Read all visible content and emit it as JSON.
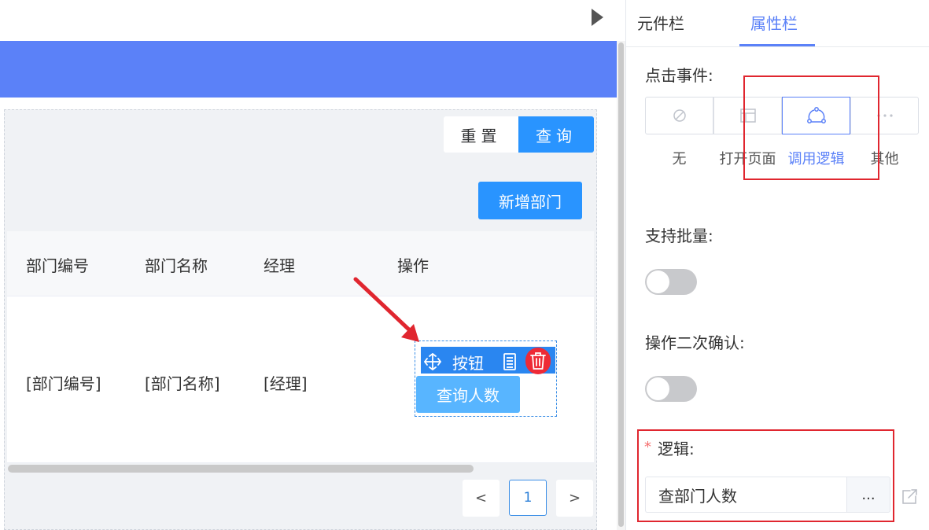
{
  "panel": {
    "tabs": [
      {
        "label": "元件栏"
      },
      {
        "label": "属性栏"
      }
    ],
    "click_event": {
      "label": "点击事件:",
      "options": [
        {
          "label": "无",
          "icon": "ban-icon"
        },
        {
          "label": "打开页面",
          "icon": "window-icon"
        },
        {
          "label": "调用逻辑",
          "icon": "flow-icon"
        },
        {
          "label": "其他",
          "icon": "ellipsis-icon"
        }
      ],
      "selected": "调用逻辑"
    },
    "batch": {
      "label": "支持批量:"
    },
    "confirm": {
      "label": "操作二次确认:"
    },
    "logic": {
      "required_mark": "*",
      "label": "逻辑:",
      "value": "查部门人数",
      "more": "..."
    }
  },
  "canvas": {
    "form": {
      "reset": "重置",
      "query": "查询"
    },
    "toolbar": {
      "add_dept": "新增部门"
    },
    "table": {
      "headers": [
        "部门编号",
        "部门名称",
        "经理",
        "操作"
      ],
      "row": [
        "[部门编号]",
        "[部门名称]",
        "[经理]"
      ]
    },
    "widget": {
      "label": "按钮",
      "button": "查询人数"
    },
    "pagination": {
      "prev": "<",
      "current": "1",
      "next": ">"
    }
  },
  "colors": {
    "banner": "#5b81f8",
    "primary": "#2994ff",
    "accent": "#5b81f8",
    "highlight": "#e0262f",
    "delete": "#ee2a36"
  }
}
